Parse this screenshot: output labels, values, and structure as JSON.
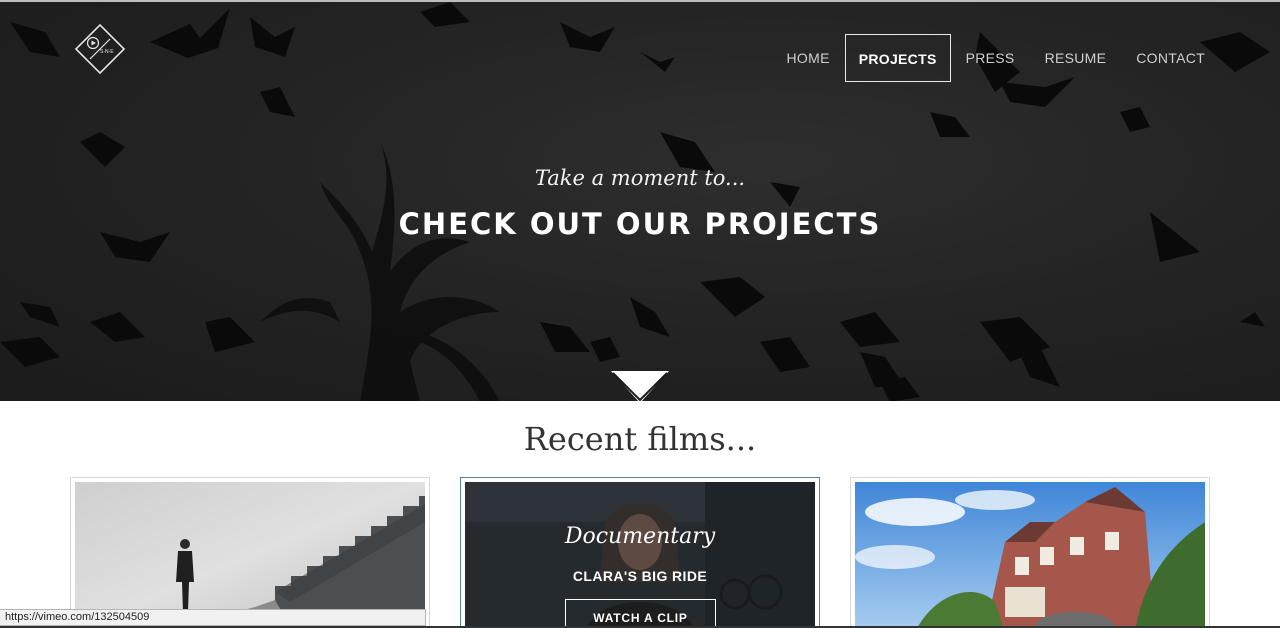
{
  "nav": {
    "items": [
      {
        "label": "HOME",
        "active": false
      },
      {
        "label": "PROJECTS",
        "active": true
      },
      {
        "label": "PRESS",
        "active": false
      },
      {
        "label": "RESUME",
        "active": false
      },
      {
        "label": "CONTACT",
        "active": false
      }
    ]
  },
  "logo": {
    "text": "S·N·E",
    "icon": "play-icon"
  },
  "hero": {
    "subtitle": "Take a moment to...",
    "title": "CHECK OUT OUR PROJECTS",
    "scroll_icon": "chevron-down-icon"
  },
  "recent": {
    "title": "Recent films...",
    "cards": [
      {
        "image": "man-at-stairs-thumbnail"
      },
      {
        "genre": "Documentary",
        "title": "CLARA'S BIG RIDE",
        "button": "WATCH A CLIP"
      },
      {
        "image": "row-houses-thumbnail"
      }
    ]
  },
  "status": {
    "url": "https://vimeo.com/132504509"
  },
  "colors": {
    "hero_bg": "#242424",
    "card_active_border": "#5a7f95"
  }
}
